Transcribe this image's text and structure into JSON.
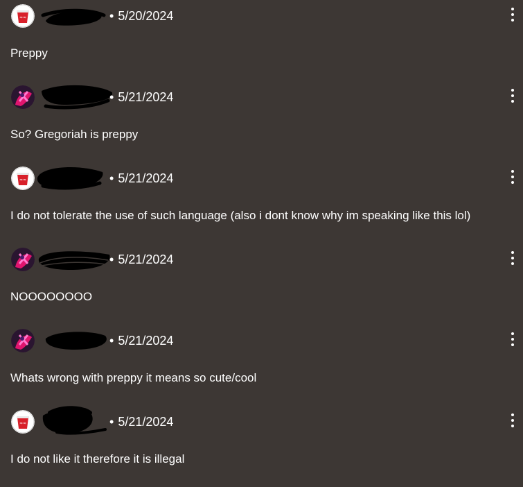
{
  "comments": [
    {
      "date": "5/20/2024",
      "text": "Preppy",
      "avatar": "cup-avatar-icon"
    },
    {
      "date": "5/21/2024",
      "text": "So? Gregoriah is preppy",
      "avatar": "character-avatar-icon"
    },
    {
      "date": "5/21/2024",
      "text": "I do not tolerate the use of such language (also i dont know why im speaking like this lol)",
      "avatar": "cup-avatar-icon"
    },
    {
      "date": "5/21/2024",
      "text": "NOOOOOOOO",
      "avatar": "character-avatar-icon"
    },
    {
      "date": "5/21/2024",
      "text": "Whats wrong with preppy it means so cute/cool",
      "avatar": "character-avatar-icon"
    },
    {
      "date": "5/21/2024",
      "text": "I do not like it therefore it is illegal",
      "avatar": "cup-avatar-icon"
    }
  ],
  "colors": {
    "background": "#3d3734",
    "text": "#ffffff",
    "redaction": "#000000",
    "cup_red": "#d8202a",
    "character_magenta": "#e0156e"
  },
  "menu_icon": "more-vertical-icon",
  "separator": "•"
}
